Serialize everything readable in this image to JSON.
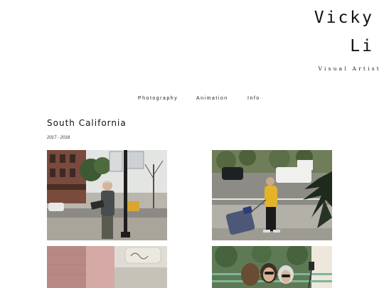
{
  "header": {
    "logo_first": "Vicky",
    "logo_last": "Li",
    "tagline": "Visual Artist"
  },
  "nav": {
    "items": [
      {
        "label": "Photography"
      },
      {
        "label": "Animation"
      },
      {
        "label": "Info"
      }
    ]
  },
  "gallery": {
    "title": "South California",
    "date": "2017 - 2018",
    "photos": [
      {
        "subject": "man reading on city sidewalk"
      },
      {
        "subject": "woman pulling suitcase across street"
      },
      {
        "subject": "pink building wall with sign"
      },
      {
        "subject": "women in sunglasses on street"
      }
    ]
  },
  "colors": {
    "background": "#ffffff",
    "text": "#111111"
  }
}
